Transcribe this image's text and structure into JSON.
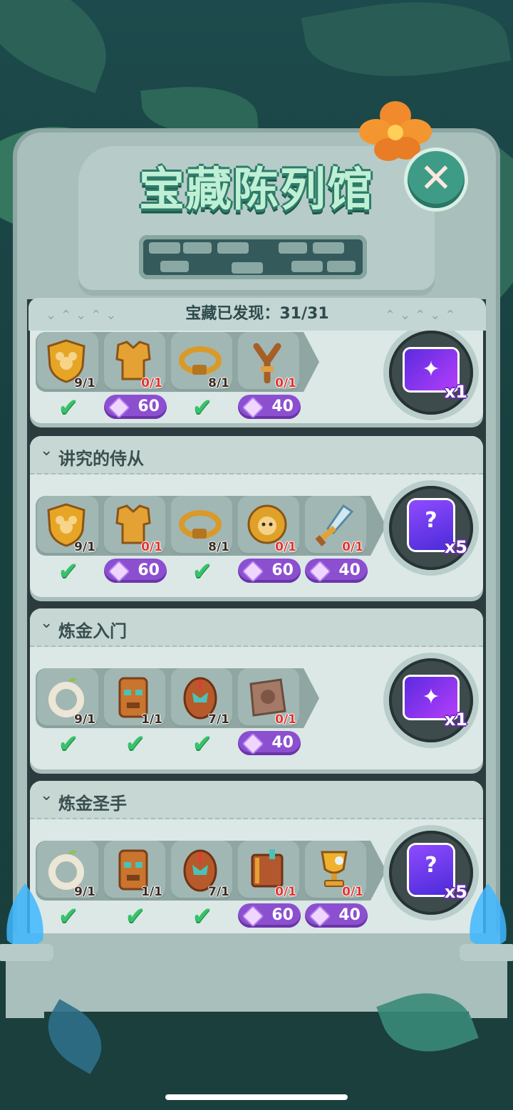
{
  "title": "宝藏陈列馆",
  "close_label": "✕",
  "counter": "宝藏已发现：31/31",
  "colors": {
    "accent": "#3e9b86",
    "gem_button": "#8c4fd0",
    "check": "#38c26a",
    "missing_count": "#e2352f"
  },
  "cards": [
    {
      "title": "",
      "items": [
        {
          "icon": "shield-mickey-icon",
          "count": "9/1",
          "collected": true
        },
        {
          "icon": "golden-armor-icon",
          "count": "0/1",
          "collected": false,
          "cost": "60"
        },
        {
          "icon": "golden-belt-icon",
          "count": "8/1",
          "collected": true
        },
        {
          "icon": "slingshot-icon",
          "count": "0/1",
          "collected": false,
          "cost": "40"
        }
      ],
      "reward": {
        "icon": "mickey-ticket-icon",
        "qty": "x1"
      }
    },
    {
      "title": "讲究的侍从",
      "items": [
        {
          "icon": "shield-mickey-icon",
          "count": "9/1",
          "collected": true
        },
        {
          "icon": "golden-armor-icon",
          "count": "0/1",
          "collected": false,
          "cost": "60"
        },
        {
          "icon": "golden-belt-icon",
          "count": "8/1",
          "collected": true
        },
        {
          "icon": "lion-medal-icon",
          "count": "0/1",
          "collected": false,
          "cost": "60"
        },
        {
          "icon": "crystal-sword-icon",
          "count": "0/1",
          "collected": false,
          "cost": "40"
        }
      ],
      "reward": {
        "icon": "mystery-chest-icon",
        "qty": "x5"
      }
    },
    {
      "title": "炼金入门",
      "items": [
        {
          "icon": "bone-ring-icon",
          "count": "9/1",
          "collected": true
        },
        {
          "icon": "tiki-mask-icon",
          "count": "1/1",
          "collected": true
        },
        {
          "icon": "tribal-shield-icon",
          "count": "7/1",
          "collected": true
        },
        {
          "icon": "stone-tablet-icon",
          "count": "0/1",
          "collected": false,
          "cost": "40"
        }
      ],
      "reward": {
        "icon": "mickey-ticket-icon",
        "qty": "x1"
      }
    },
    {
      "title": "炼金圣手",
      "items": [
        {
          "icon": "bone-ring-icon",
          "count": "9/1",
          "collected": true
        },
        {
          "icon": "tiki-mask-icon",
          "count": "1/1",
          "collected": true
        },
        {
          "icon": "tribal-shield-icon",
          "count": "7/1",
          "collected": true
        },
        {
          "icon": "spell-book-icon",
          "count": "0/1",
          "collected": false,
          "cost": "60"
        },
        {
          "icon": "golden-trophy-icon",
          "count": "0/1",
          "collected": false,
          "cost": "40"
        }
      ],
      "reward": {
        "icon": "mystery-chest-icon",
        "qty": "x5"
      }
    }
  ]
}
